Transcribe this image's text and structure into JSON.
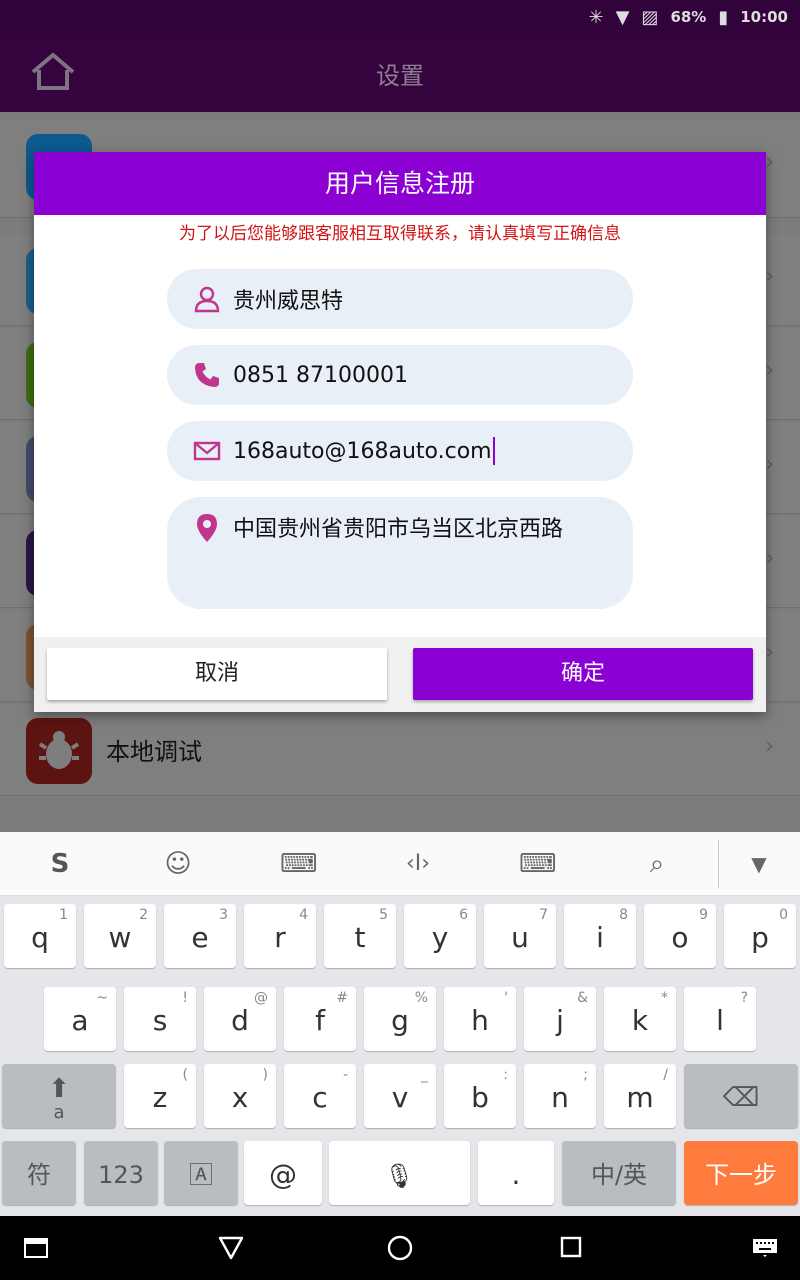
{
  "status_bar": {
    "battery": "68%",
    "time": "10:00"
  },
  "app_bar": {
    "title": "设置"
  },
  "background_list": {
    "visible_item_label": "本地调试"
  },
  "dialog": {
    "title": "用户信息注册",
    "note": "为了以后您能够跟客服相互取得联系，请认真填写正确信息",
    "fields": {
      "name": "贵州威思特",
      "phone": "0851 87100001",
      "email": "168auto@168auto.com",
      "address": "中国贵州省贵阳市乌当区北京西路"
    },
    "cancel_label": "取消",
    "confirm_label": "确定"
  },
  "keyboard": {
    "row1": [
      [
        "q",
        "1"
      ],
      [
        "w",
        "2"
      ],
      [
        "e",
        "3"
      ],
      [
        "r",
        "4"
      ],
      [
        "t",
        "5"
      ],
      [
        "y",
        "6"
      ],
      [
        "u",
        "7"
      ],
      [
        "i",
        "8"
      ],
      [
        "o",
        "9"
      ],
      [
        "p",
        "0"
      ]
    ],
    "row2": [
      [
        "a",
        "~"
      ],
      [
        "s",
        "!"
      ],
      [
        "d",
        "@"
      ],
      [
        "f",
        "#"
      ],
      [
        "g",
        "%"
      ],
      [
        "h",
        "'"
      ],
      [
        "j",
        "&"
      ],
      [
        "k",
        "*"
      ],
      [
        "l",
        "?"
      ]
    ],
    "row3": [
      [
        "z",
        "("
      ],
      [
        "x",
        ")"
      ],
      [
        "c",
        "-"
      ],
      [
        "v",
        "_"
      ],
      [
        "b",
        ":"
      ],
      [
        "n",
        ";"
      ],
      [
        "m",
        "/"
      ]
    ],
    "shift_sub": "a",
    "symbols_label": "符",
    "numbers_label": "123",
    "at_label": "@",
    "period_label": ".",
    "lang_label": "中/英",
    "next_label": "下一步"
  },
  "colors": {
    "accent": "#8b00d3",
    "next_key": "#ff7a3d",
    "note_red": "#d21414"
  }
}
